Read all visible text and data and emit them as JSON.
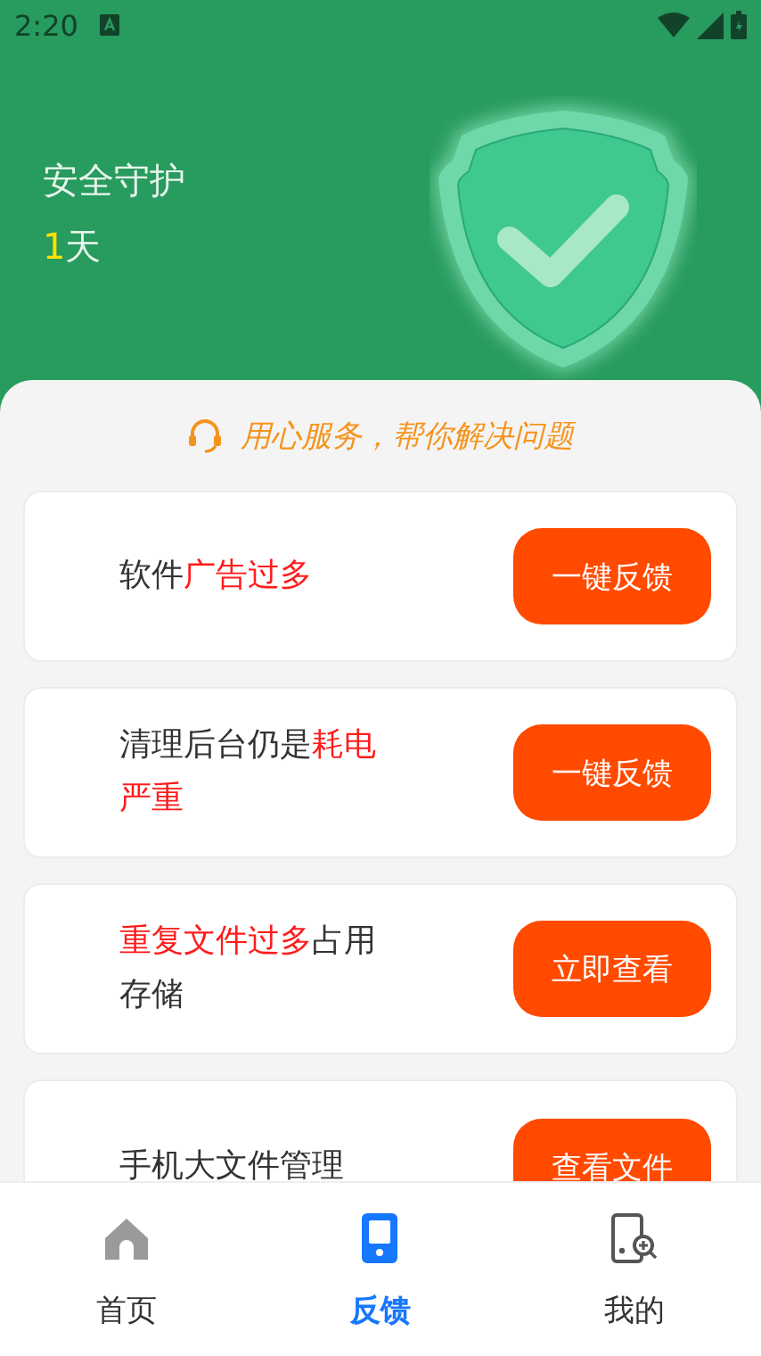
{
  "status_bar": {
    "time": "2:20"
  },
  "header": {
    "title": "安全守护",
    "days": {
      "number": "1",
      "unit": "天"
    }
  },
  "slogan": "用心服务，帮你解决问题",
  "cards": [
    {
      "segments": [
        {
          "text": "软件",
          "highlight": false
        },
        {
          "text": "广告过多",
          "highlight": true
        }
      ],
      "button": "一键反馈"
    },
    {
      "segments": [
        {
          "text": "清理后台仍是",
          "highlight": false
        },
        {
          "text": "耗电严重",
          "highlight": true
        }
      ],
      "button": "一键反馈"
    },
    {
      "segments": [
        {
          "text": "重复文件过多",
          "highlight": true
        },
        {
          "text": "占用存储",
          "highlight": false
        }
      ],
      "button": "立即查看"
    },
    {
      "segments": [
        {
          "text": "手机大文件管理",
          "highlight": false
        }
      ],
      "button": "查看文件"
    }
  ],
  "tabs": [
    {
      "label": "首页",
      "kind": "home",
      "selected": false
    },
    {
      "label": "反馈",
      "kind": "phone",
      "selected": true
    },
    {
      "label": "我的",
      "kind": "phone-search",
      "selected": false
    }
  ]
}
